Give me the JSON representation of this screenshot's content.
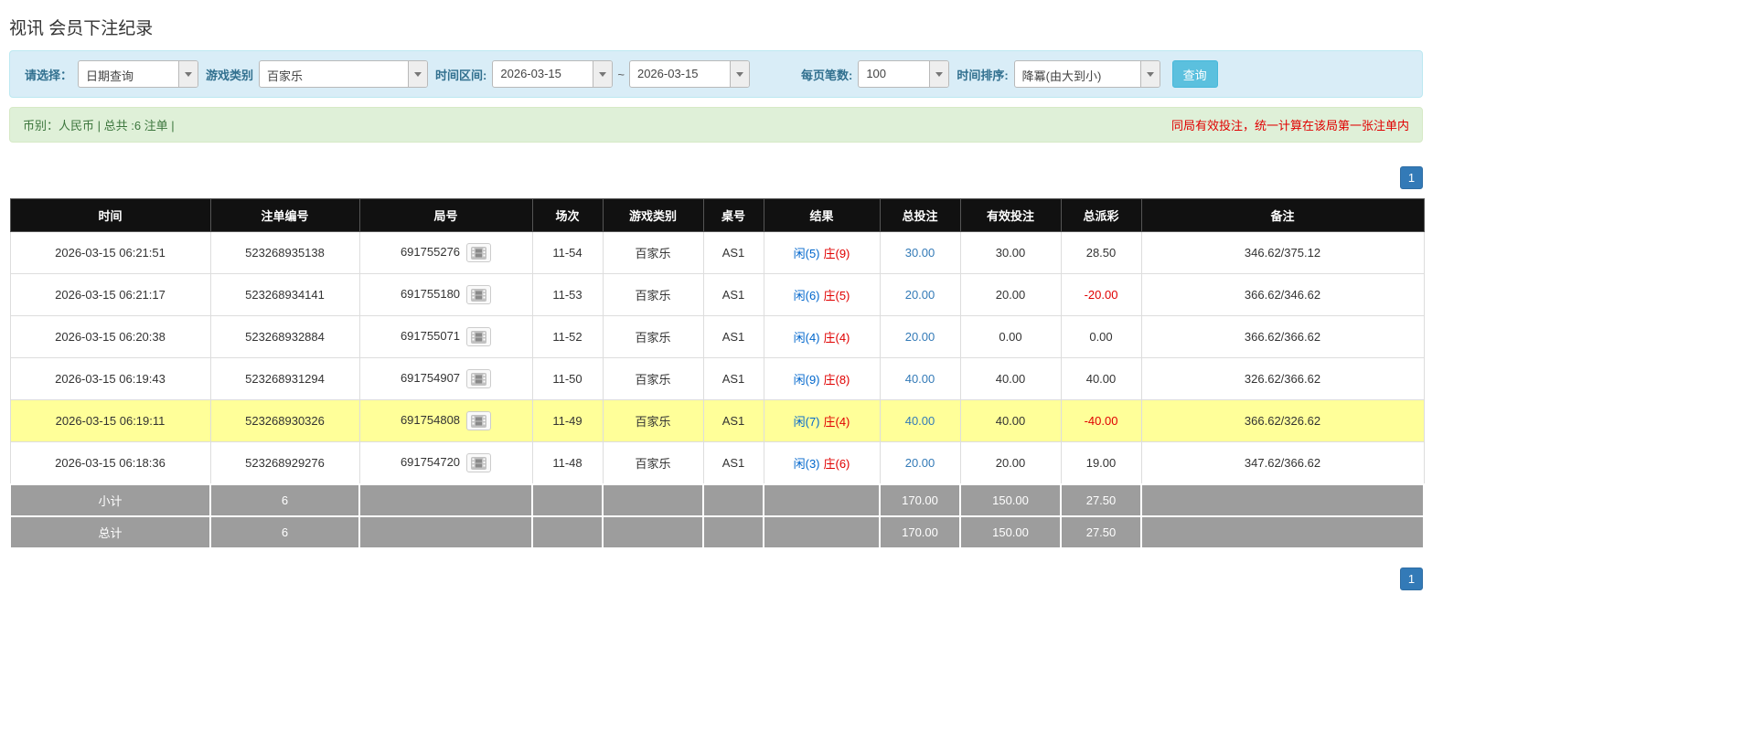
{
  "page": {
    "title": "视讯 会员下注纪录"
  },
  "filter": {
    "query_type_label": "请选择：",
    "query_type_value": "日期查询",
    "game_type_label": "游戏类别",
    "game_type_value": "百家乐",
    "date_range_label": "时间区间:",
    "date_from": "2026-03-15",
    "tilde": "~",
    "date_to": "2026-03-15",
    "page_size_label": "每页笔数:",
    "page_size_value": "100",
    "sort_label": "时间排序:",
    "sort_value": "降冪(由大到小)",
    "search_button_label": "查询"
  },
  "summary": {
    "left_text": "币别：人民币 | 总共 :6 注单 |",
    "right_note": "同局有效投注，统一计算在该局第一张注单内"
  },
  "pagination": {
    "current_page": "1"
  },
  "table": {
    "headers": [
      "时间",
      "注单编号",
      "局号",
      "场次",
      "游戏类别",
      "桌号",
      "结果",
      "总投注",
      "有效投注",
      "总派彩",
      "备注"
    ],
    "rows": [
      {
        "time": "2026-03-15 06:21:51",
        "bet_id": "523268935138",
        "round_id": "691755276",
        "session": "11-54",
        "game": "百家乐",
        "table_no": "AS1",
        "result_player": "闲(5)",
        "result_banker": "庄(9)",
        "total_bet": "30.00",
        "valid_bet": "30.00",
        "payout": "28.50",
        "remark": "346.62/375.12",
        "highlight": false
      },
      {
        "time": "2026-03-15 06:21:17",
        "bet_id": "523268934141",
        "round_id": "691755180",
        "session": "11-53",
        "game": "百家乐",
        "table_no": "AS1",
        "result_player": "闲(6)",
        "result_banker": "庄(5)",
        "total_bet": "20.00",
        "valid_bet": "20.00",
        "payout": "-20.00",
        "remark": "366.62/346.62",
        "highlight": false
      },
      {
        "time": "2026-03-15 06:20:38",
        "bet_id": "523268932884",
        "round_id": "691755071",
        "session": "11-52",
        "game": "百家乐",
        "table_no": "AS1",
        "result_player": "闲(4)",
        "result_banker": "庄(4)",
        "total_bet": "20.00",
        "valid_bet": "0.00",
        "payout": "0.00",
        "remark": "366.62/366.62",
        "highlight": false
      },
      {
        "time": "2026-03-15 06:19:43",
        "bet_id": "523268931294",
        "round_id": "691754907",
        "session": "11-50",
        "game": "百家乐",
        "table_no": "AS1",
        "result_player": "闲(9)",
        "result_banker": "庄(8)",
        "total_bet": "40.00",
        "valid_bet": "40.00",
        "payout": "40.00",
        "remark": "326.62/366.62",
        "highlight": false
      },
      {
        "time": "2026-03-15 06:19:11",
        "bet_id": "523268930326",
        "round_id": "691754808",
        "session": "11-49",
        "game": "百家乐",
        "table_no": "AS1",
        "result_player": "闲(7)",
        "result_banker": "庄(4)",
        "total_bet": "40.00",
        "valid_bet": "40.00",
        "payout": "-40.00",
        "remark": "366.62/326.62",
        "highlight": true
      },
      {
        "time": "2026-03-15 06:18:36",
        "bet_id": "523268929276",
        "round_id": "691754720",
        "session": "11-48",
        "game": "百家乐",
        "table_no": "AS1",
        "result_player": "闲(3)",
        "result_banker": "庄(6)",
        "total_bet": "20.00",
        "valid_bet": "20.00",
        "payout": "19.00",
        "remark": "347.62/366.62",
        "highlight": false
      }
    ],
    "subtotal_row": {
      "label": "小计",
      "count": "6",
      "total_bet": "170.00",
      "valid_bet": "150.00",
      "payout": "27.50"
    },
    "total_row": {
      "label": "总计",
      "count": "6",
      "total_bet": "170.00",
      "valid_bet": "150.00",
      "payout": "27.50"
    }
  },
  "icons": {
    "dropdown": "caret-down-icon",
    "round_media": "video-replay-icon"
  },
  "colors": {
    "accent_blue": "#337ab7",
    "search_button_blue": "#5bc0de",
    "player_blue": "#0066cc",
    "banker_red": "#e00000",
    "negative_red": "#e00000",
    "note_red": "#e00000",
    "highlight_yellow": "#ffff99",
    "filter_bar_bg": "#d9edf7",
    "summary_bar_bg": "#dff0d8",
    "table_header_bg": "#111111",
    "table_footer_bg": "#9d9d9d"
  }
}
